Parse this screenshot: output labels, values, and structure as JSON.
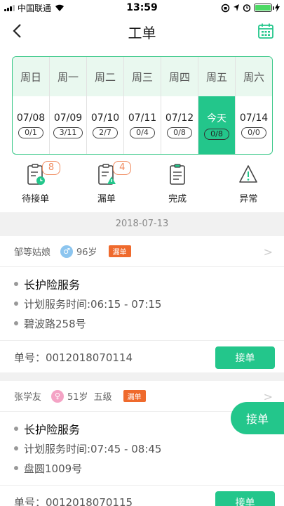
{
  "status_bar": {
    "carrier": "中国联通",
    "time": "13:59"
  },
  "nav": {
    "title": "工单"
  },
  "week": [
    {
      "name": "周日",
      "date": "07/08",
      "count": "0/1"
    },
    {
      "name": "周一",
      "date": "07/09",
      "count": "3/11"
    },
    {
      "name": "周二",
      "date": "07/10",
      "count": "2/7"
    },
    {
      "name": "周三",
      "date": "07/11",
      "count": "0/4"
    },
    {
      "name": "周四",
      "date": "07/12",
      "count": "0/8"
    },
    {
      "name": "周五",
      "date": "今天",
      "count": "0/8"
    },
    {
      "name": "周六",
      "date": "07/14",
      "count": "0/0"
    }
  ],
  "categories": [
    {
      "label": "待接单",
      "badge": "8"
    },
    {
      "label": "漏单",
      "badge": "4"
    },
    {
      "label": "完成"
    },
    {
      "label": "异常"
    }
  ],
  "date_header": "2018-07-13",
  "orders": [
    {
      "name": "邹等姑娘",
      "gender": "♂",
      "age": "96岁",
      "level": "",
      "tag": "漏单",
      "service": "长护险服务",
      "time": "计划服务时间:06:15 - 07:15",
      "address": "碧波路258号",
      "order_no": "单号：0012018070114",
      "button": "接单"
    },
    {
      "name": "张学友",
      "gender": "♀",
      "age": "51岁",
      "level": "五级",
      "tag": "漏单",
      "service": "长护险服务",
      "time": "计划服务时间:07:45 - 08:45",
      "address": "盘圆1009号",
      "order_no": "单号：0012018070115",
      "button": "接单"
    }
  ],
  "float_button": "接单",
  "colors": {
    "accent": "#23c68b",
    "tag": "#ef6a2d",
    "badge": "#f08a5d"
  }
}
